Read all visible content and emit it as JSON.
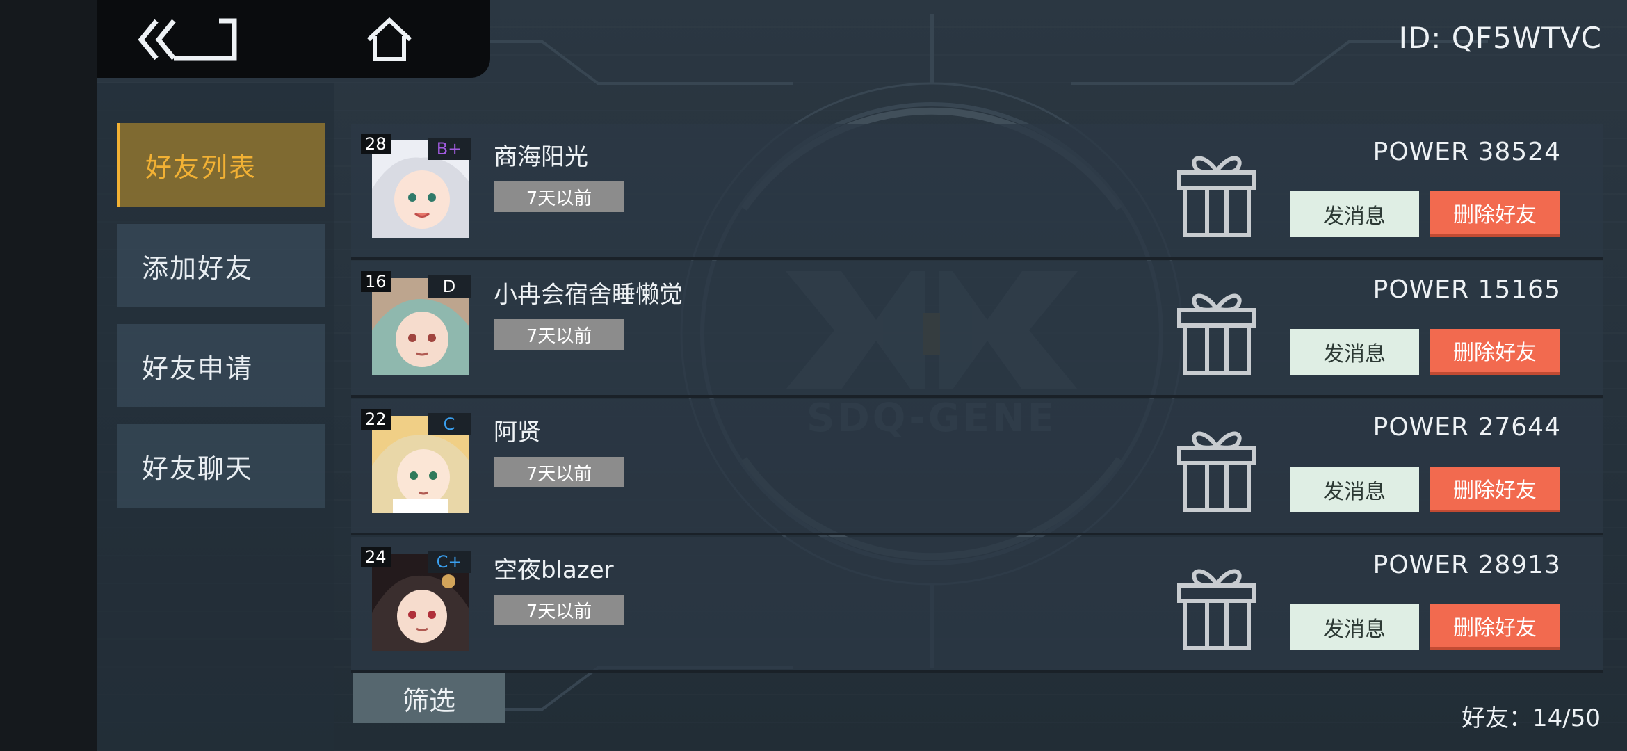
{
  "header": {
    "player_id": "ID: QF5WTVC",
    "back_icon": "double-chevron-back-icon",
    "home_icon": "home-icon"
  },
  "background": {
    "logo_text": "SDQ-GENE"
  },
  "sidebar": {
    "items": [
      {
        "label": "好友列表",
        "active": true
      },
      {
        "label": "添加好友",
        "active": false
      },
      {
        "label": "好友申请",
        "active": false
      },
      {
        "label": "好友聊天",
        "active": false
      }
    ]
  },
  "friends": [
    {
      "level": "28",
      "rank": "B+",
      "rank_color": "#a25be0",
      "name": "商海阳光",
      "last_seen": "7天以前",
      "power": "POWER 38524",
      "msg_label": "发消息",
      "delete_label": "删除好友"
    },
    {
      "level": "16",
      "rank": "D",
      "rank_color": "#ffffff",
      "name": "小冉会宿舍睡懒觉",
      "last_seen": "7天以前",
      "power": "POWER 15165",
      "msg_label": "发消息",
      "delete_label": "删除好友"
    },
    {
      "level": "22",
      "rank": "C",
      "rank_color": "#3aa0f0",
      "name": "阿贤",
      "last_seen": "7天以前",
      "power": "POWER 27644",
      "msg_label": "发消息",
      "delete_label": "删除好友"
    },
    {
      "level": "24",
      "rank": "C+",
      "rank_color": "#3aa0f0",
      "name": "空夜blazer",
      "last_seen": "7天以前",
      "power": "POWER 28913",
      "msg_label": "发消息",
      "delete_label": "删除好友"
    }
  ],
  "footer": {
    "filter_label": "筛选",
    "friend_count": "好友：14/50"
  },
  "colors": {
    "accent_gold": "#f2b134",
    "delete_red": "#f26a4f",
    "message_green": "#dfeee4"
  }
}
